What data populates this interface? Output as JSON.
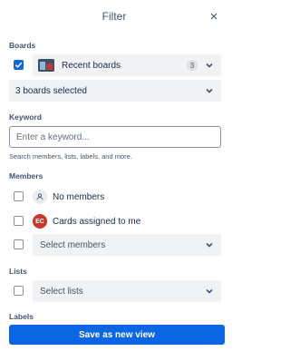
{
  "header": {
    "title": "Filter",
    "close_icon": "×"
  },
  "boards": {
    "label": "Boards",
    "recent": {
      "label": "Recent boards",
      "count": "3",
      "checked": true
    },
    "selected_summary": "3 boards selected"
  },
  "keyword": {
    "label": "Keyword",
    "placeholder": "Enter a keyword...",
    "value": "",
    "help": "Search members, lists, labels, and more."
  },
  "members": {
    "label": "Members",
    "no_members": "No members",
    "assigned_to_me": "Cards assigned to me",
    "avatar_initials": "EC",
    "select_placeholder": "Select members"
  },
  "lists": {
    "label": "Lists",
    "select_placeholder": "Select lists"
  },
  "labels": {
    "label": "Labels"
  },
  "footer": {
    "save_label": "Save as new view"
  },
  "colors": {
    "accent": "#0c66e4",
    "avatar": "#c9372c"
  }
}
